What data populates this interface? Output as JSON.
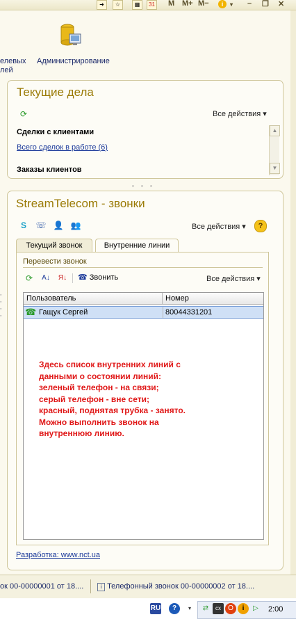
{
  "toolbar": {
    "calendar_day": "31",
    "m_label": "M",
    "mplus_label": "M+",
    "mminus_label": "M−",
    "info_icon": "info-icon",
    "minimize_label": "–",
    "restore_label": "❐",
    "close_label": "✕"
  },
  "nav": {
    "partial_label_line1": "елевых",
    "partial_label_line2": "лей",
    "admin_label": "Администрирование"
  },
  "current_tasks": {
    "title": "Текущие дела",
    "all_actions": "Все действия",
    "section1_header": "Сделки с клиентами",
    "section1_link": "Всего сделок в работе (6)",
    "section2_header": "Заказы клиентов"
  },
  "stream": {
    "title": "StreamTelecom - звонки",
    "all_actions": "Все действия",
    "help_label": "?",
    "tabs": [
      {
        "label": "Текущий звонок",
        "active": false
      },
      {
        "label": "Внутренние линии",
        "active": true
      }
    ],
    "transfer_label": "Перевести звонок",
    "call_label": "Звонить",
    "grid_all_actions": "Все действия",
    "columns": [
      "Пользователь",
      "Номер"
    ],
    "rows": [
      {
        "user": "Гащук Сергей",
        "number": "80044331201",
        "status": "green"
      }
    ],
    "note": "Здесь список внутренних линий с\nданными о состоянии линий:\nзеленый телефон - на связи;\nсерый телефон - вне сети;\nкрасный, поднятая трубка - занято.\nМожно выполнить звонок на\nвнутреннюю линию.",
    "dev_link": "Разработка: www.nct.ua"
  },
  "taskbar": {
    "item1": "ок 00-00000001 от 18....",
    "item2": "Телефонный звонок 00-00000002 от 18...."
  },
  "tray": {
    "lang": "RU",
    "help": "?",
    "clock": "2:00"
  },
  "colors": {
    "accent_title": "#9a7a05",
    "note_red": "#e01818",
    "row_selected": "#cfe0f6",
    "status_green": "#2a9a2a"
  }
}
